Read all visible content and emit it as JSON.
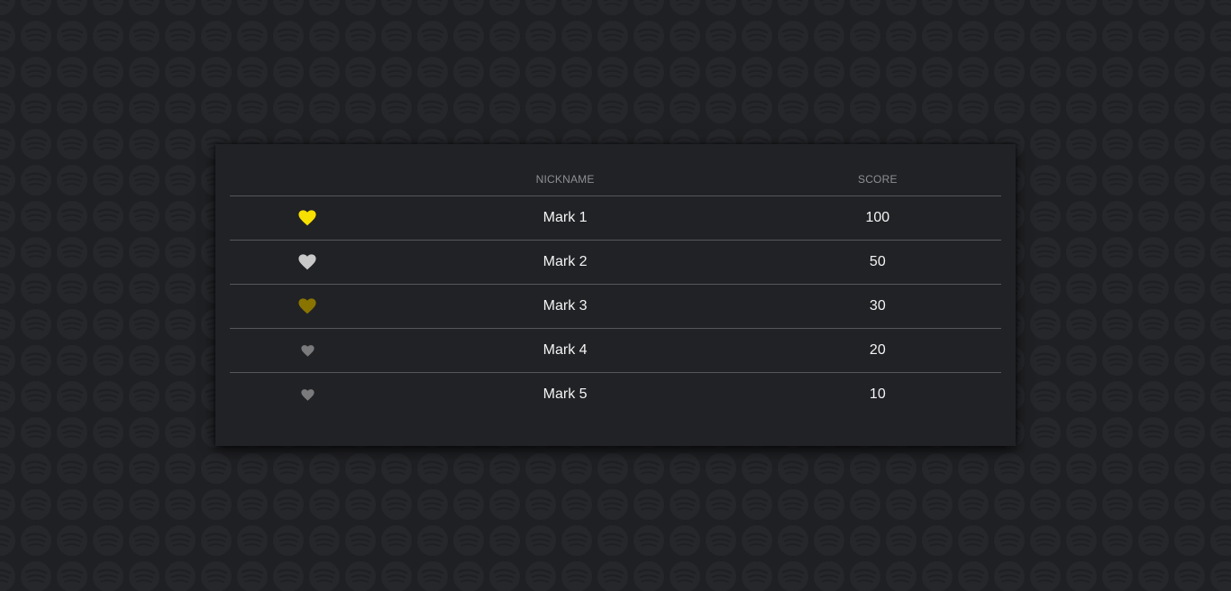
{
  "leaderboard": {
    "columns": {
      "rank": "",
      "nickname": "NICKNAME",
      "score": "SCORE"
    },
    "rows": [
      {
        "nickname": "Mark 1",
        "score": "100",
        "medal_icon": "gold-heart-icon",
        "medal_color": "#f7e000"
      },
      {
        "nickname": "Mark 2",
        "score": "50",
        "medal_icon": "silver-heart-icon",
        "medal_color": "#c9c9c9"
      },
      {
        "nickname": "Mark 3",
        "score": "30",
        "medal_icon": "bronze-heart-icon",
        "medal_color": "#8a7400"
      },
      {
        "nickname": "Mark 4",
        "score": "20",
        "medal_icon": "heart-icon",
        "medal_color": "#7a7a7c"
      },
      {
        "nickname": "Mark 5",
        "score": "10",
        "medal_icon": "heart-icon",
        "medal_color": "#7a7a7c"
      }
    ]
  },
  "theme": {
    "background": "#1f2023",
    "card": "#212226",
    "divider": "#56575b",
    "header_text": "#8e8f93",
    "cell_text": "#f4f4f4"
  }
}
